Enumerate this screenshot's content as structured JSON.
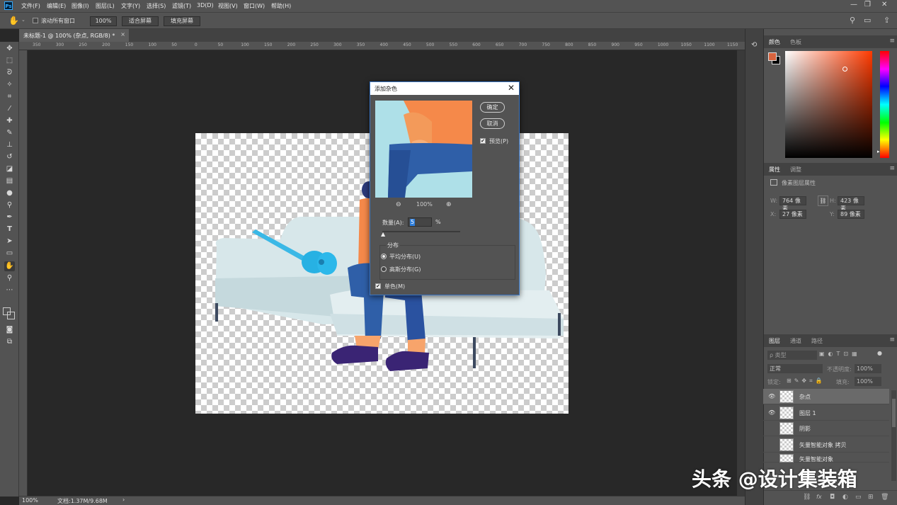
{
  "app": {
    "logo": "Ps"
  },
  "menubar": {
    "items": [
      "文件(F)",
      "编辑(E)",
      "图像(I)",
      "图层(L)",
      "文字(Y)",
      "选择(S)",
      "滤镜(T)",
      "3D(D)",
      "视图(V)",
      "窗口(W)",
      "帮助(H)"
    ],
    "window_controls": [
      "—",
      "❐",
      "✕"
    ]
  },
  "options_bar": {
    "scroll_all_label": "滚动所有窗口",
    "zoom_value": "100%",
    "fit_screen": "适合屏幕",
    "fill_screen": "填充屏幕"
  },
  "document": {
    "tab_title": "未标题-1 @ 100% (杂点, RGB/8) *",
    "tab_close": "×",
    "ruler_h_ticks": [
      "350",
      "300",
      "250",
      "200",
      "150",
      "100",
      "50",
      "0",
      "50",
      "100",
      "150",
      "200",
      "250",
      "300",
      "350",
      "400",
      "450",
      "500",
      "550",
      "600",
      "650",
      "700",
      "750",
      "800",
      "850",
      "900",
      "950",
      "1000",
      "1050",
      "1100",
      "1150"
    ]
  },
  "status_bar": {
    "zoom": "100%",
    "doc_info": "文档:1.37M/9.68M",
    "arrow": "›"
  },
  "panels": {
    "color": {
      "tabs": [
        "颜色",
        "色板"
      ],
      "foreground": "#d9643f",
      "background": "#000000"
    },
    "properties": {
      "tabs": [
        "属性",
        "调整"
      ],
      "subtitle": "像素图层属性",
      "w_label": "W:",
      "w_value": "764 像素",
      "h_label": "H:",
      "h_value": "423 像素",
      "x_label": "X:",
      "x_value": "27 像素",
      "y_label": "Y:",
      "y_value": "89 像素"
    },
    "layers": {
      "tabs": [
        "图层",
        "通道",
        "路径"
      ],
      "search_placeholder": "ρ 类型",
      "blend_mode": "正常",
      "opacity_label": "不透明度:",
      "opacity_value": "100%",
      "lock_label": "锁定:",
      "fill_label": "填充:",
      "fill_value": "100%",
      "items": [
        {
          "name": "杂点",
          "visible": true,
          "selected": true
        },
        {
          "name": "图层 1",
          "visible": true,
          "selected": false
        },
        {
          "name": "阴影",
          "visible": false,
          "selected": false
        },
        {
          "name": "矢量智能对象 拷贝",
          "visible": false,
          "selected": false
        },
        {
          "name": "矢量智能对象",
          "visible": false,
          "selected": false
        }
      ],
      "bottom_icons": [
        "link-icon",
        "fx-icon",
        "mask-icon",
        "adjustment-icon",
        "group-icon",
        "new-layer-icon",
        "trash-icon"
      ]
    }
  },
  "dialog": {
    "title": "添加杂色",
    "ok": "确定",
    "cancel": "取消",
    "preview_label": "预览(P)",
    "preview_checked": true,
    "zoom": "100%",
    "amount_label": "数量(A):",
    "amount_value": "5",
    "amount_unit": "%",
    "distribution_label": "分布",
    "uniform_label": "平均分布(U)",
    "gaussian_label": "高斯分布(G)",
    "distribution_selected": "uniform",
    "monochromatic_label": "单色(M)",
    "monochromatic_checked": true
  },
  "watermark": "头条 @设计集装箱"
}
